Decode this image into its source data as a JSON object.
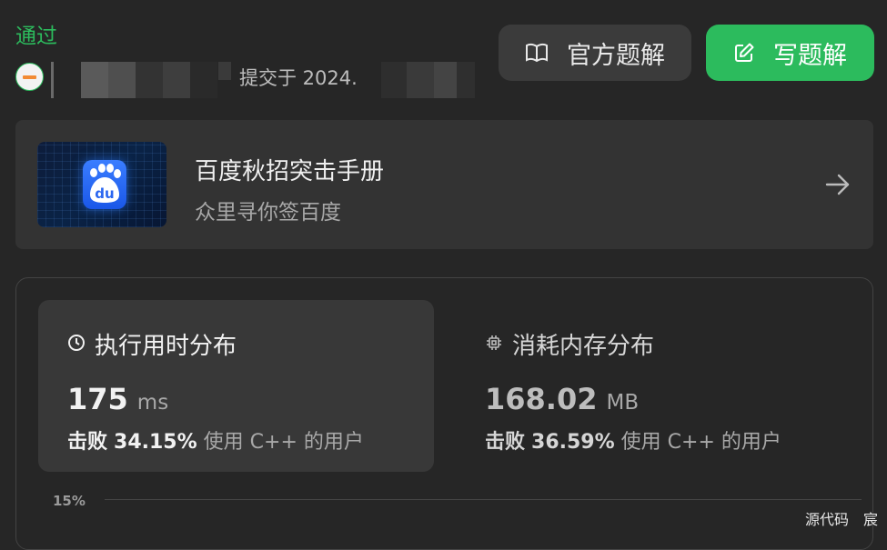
{
  "header": {
    "status": "通过",
    "submitted_text": "提交于 2024."
  },
  "buttons": {
    "official_solution": "官方题解",
    "write_solution": "写题解"
  },
  "promo": {
    "title": "百度秋招突击手册",
    "subtitle": "众里寻你签百度",
    "logo_text": "du"
  },
  "runtime": {
    "title": "执行用时分布",
    "value": "175",
    "unit": "ms",
    "beat_label": "击败",
    "beat_percent": "34.15%",
    "beat_suffix": "使用 C++ 的用户"
  },
  "memory": {
    "title": "消耗内存分布",
    "value": "168.02",
    "unit": "MB",
    "beat_label": "击败",
    "beat_percent": "36.59%",
    "beat_suffix": "使用 C++ 的用户"
  },
  "chart_axis": {
    "y_tick": "15%"
  },
  "footer": {
    "source_code": "源代码",
    "user_char": "宸"
  },
  "colors": {
    "accent_green": "#2cbb5d",
    "background": "#262626",
    "card": "#383838"
  }
}
